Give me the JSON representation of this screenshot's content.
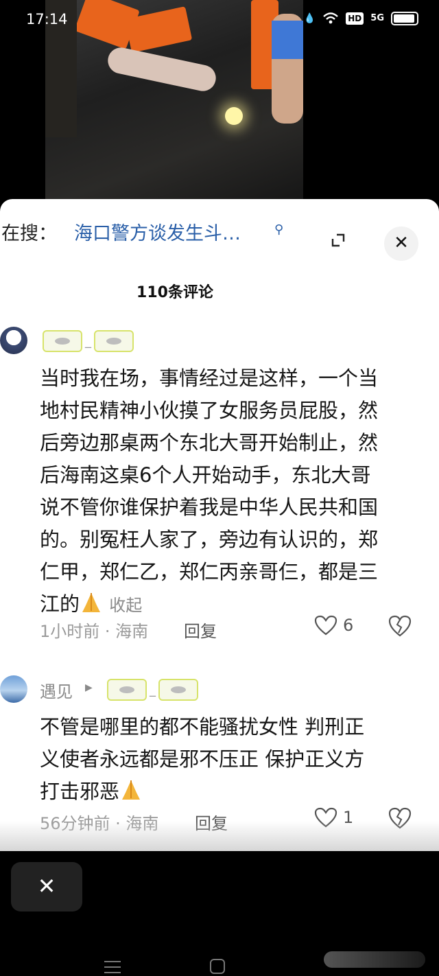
{
  "status_bar": {
    "time": "17:14",
    "icons": [
      "wifi-icon",
      "hd-icon",
      "5g-icon",
      "battery-icon"
    ],
    "hd": "HD",
    "network": "5G"
  },
  "search": {
    "prefix": "在搜：",
    "query": "海口警方谈发生斗…",
    "icon": "search-icon"
  },
  "comment_count": "110条评论",
  "comments": [
    {
      "username": "",
      "text_lines": [
        "当时我在场，事情经过是这样，一个当",
        "地村民精神小伙摸了女服务员屁股，然",
        "后旁边那桌两个东北大哥开始制止，然",
        "后海南这桌6个人开始动手，东北大哥",
        "说不管你谁保护着我是中华人民共和国",
        "的。别冤枉人家了，旁边有认识的，郑",
        "仁甲，郑仁乙，郑仁丙亲哥仨，都是三",
        "江的"
      ],
      "collapse": "收起",
      "meta": "1小时前 · 海南",
      "reply": "回复",
      "likes": "6"
    },
    {
      "username": "遇见",
      "text_lines": [
        "不管是哪里的都不能骚扰女性  判刑正",
        "义使者永远都是邪不压正  保护正义方",
        "打击邪恶"
      ],
      "meta": "56分钟前 · 海南",
      "reply": "回复",
      "likes": "1"
    }
  ],
  "colors": {
    "link": "#2a5fa8",
    "sheet_bg": "#ffffff",
    "page_bg": "#000000",
    "muted": "#9a9a9a"
  }
}
